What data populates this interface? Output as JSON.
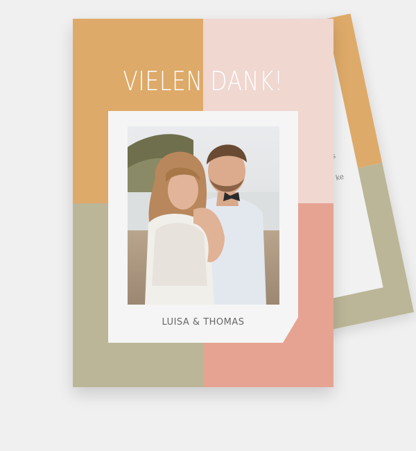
{
  "colors": {
    "background": "#f0f0f0",
    "ochre": "#deaa69",
    "blush": "#f0d7d0",
    "sage": "#bbb697",
    "salmon": "#e6a392",
    "paper": "#f5f5f5",
    "inner_paper": "#f1f1f1"
  },
  "front_card": {
    "title": "VIELEN DANK!",
    "names": "LUISA & THOMAS"
  },
  "back_card": {
    "visible_text_1": "ss",
    "visible_text_2": "ke"
  },
  "photo": {
    "subject": "couple-portrait"
  }
}
